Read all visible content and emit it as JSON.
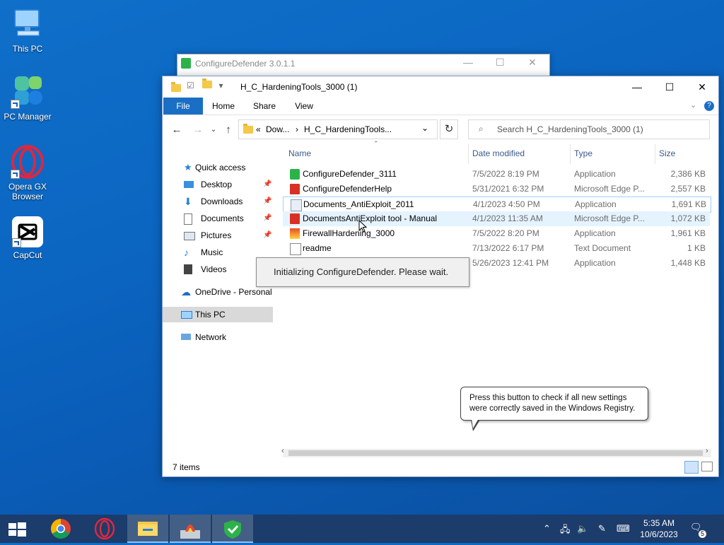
{
  "desktop": {
    "icons": [
      {
        "label": "This PC"
      },
      {
        "label": "PC Manager"
      },
      {
        "label": "Opera GX Browser"
      },
      {
        "label": "CapCut"
      }
    ]
  },
  "background_window": {
    "title": "ConfigureDefender 3.0.1.1"
  },
  "explorer": {
    "title": "H_C_HardeningTools_3000 (1)",
    "ribbon_tabs": [
      "File",
      "Home",
      "Share",
      "View"
    ],
    "address": {
      "prefix": "«",
      "crumb1": "Dow...",
      "sep": "›",
      "crumb2": "H_C_HardeningTools..."
    },
    "search_placeholder": "Search H_C_HardeningTools_3000 (1)",
    "nav_pane": [
      {
        "label": "Quick access",
        "pinned": false
      },
      {
        "label": "Desktop",
        "pinned": true
      },
      {
        "label": "Downloads",
        "pinned": true
      },
      {
        "label": "Documents",
        "pinned": true
      },
      {
        "label": "Pictures",
        "pinned": true
      },
      {
        "label": "Music",
        "pinned": false
      },
      {
        "label": "Videos",
        "pinned": false
      },
      {
        "label": "OneDrive - Personal",
        "pinned": false
      },
      {
        "label": "This PC",
        "pinned": false,
        "selected": true
      },
      {
        "label": "Network",
        "pinned": false
      }
    ],
    "columns": [
      "Name",
      "Date modified",
      "Type",
      "Size"
    ],
    "files": [
      {
        "name": "ConfigureDefender_3111",
        "date": "7/5/2022 8:19 PM",
        "type": "Application",
        "size": "2,386 KB",
        "icon": "app-shield-icon"
      },
      {
        "name": "ConfigureDefenderHelp",
        "date": "5/31/2021 6:32 PM",
        "type": "Microsoft Edge P...",
        "size": "2,557 KB",
        "icon": "pdf-icon"
      },
      {
        "name": "Documents_AntiExploit_2011",
        "date": "4/1/2023 4:50 PM",
        "type": "Application",
        "size": "1,691 KB",
        "icon": "app-icon"
      },
      {
        "name": "DocumentsAntiExploit tool - Manual",
        "date": "4/1/2023 11:35 AM",
        "type": "Microsoft Edge P...",
        "size": "1,072 KB",
        "icon": "pdf-icon"
      },
      {
        "name": "FirewallHardening_3000",
        "date": "7/5/2022 8:20 PM",
        "type": "Application",
        "size": "1,961 KB",
        "icon": "firewall-icon"
      },
      {
        "name": "readme",
        "date": "7/13/2022 6:17 PM",
        "type": "Text Document",
        "size": "1 KB",
        "icon": "text-file-icon"
      },
      {
        "name": "",
        "date": "5/26/2023 12:41 PM",
        "type": "Application",
        "size": "1,448 KB",
        "icon": "app-icon"
      }
    ],
    "status": "7 items"
  },
  "init_message": "Initializing ConfigureDefender. Please wait.",
  "tooltip": "Press this button to check if all new settings were correctly saved in the Windows Registry.",
  "taskbar": {
    "time": "5:35 AM",
    "date": "10/6/2023",
    "notification_count": "5"
  }
}
